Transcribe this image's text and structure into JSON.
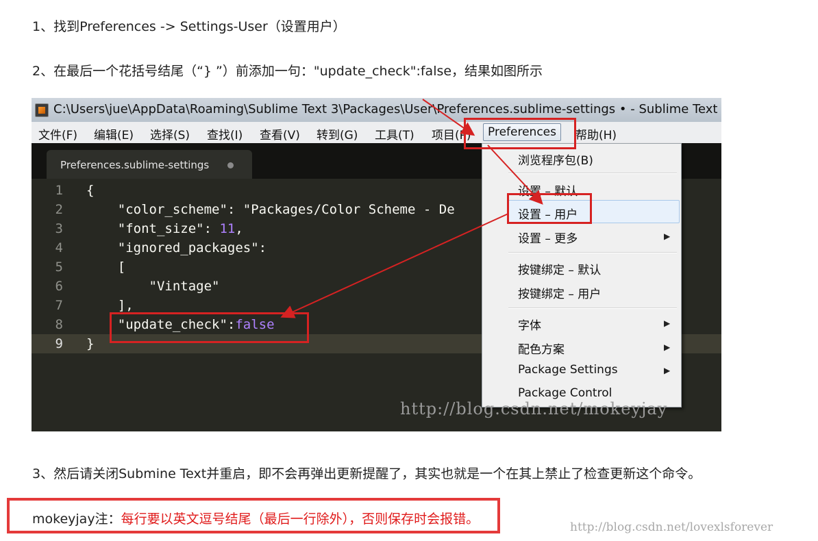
{
  "steps": {
    "step1": "1、找到Preferences -> Settings-User（设置用户）",
    "step2": "2、在最后一个花括号结尾（“} ”）前添加一句：\"update_check\":false，结果如图所示",
    "step3": "3、然后请关闭Submine Text并重启，即不会再弹出更新提醒了，其实也就是一个在其上禁止了检查更新这个命令。"
  },
  "window": {
    "title": "C:\\Users\\jue\\AppData\\Roaming\\Sublime Text 3\\Packages\\User\\Preferences.sublime-settings • - Sublime Text"
  },
  "menubar": [
    "文件(F)",
    "编辑(E)",
    "选择(S)",
    "查找(I)",
    "查看(V)",
    "转到(G)",
    "工具(T)",
    "项目(P)",
    "Preferences",
    "帮助(H)"
  ],
  "tab": {
    "label": "Preferences.sublime-settings"
  },
  "editor": {
    "line_numbers": [
      "1",
      "2",
      "3",
      "4",
      "5",
      "6",
      "7",
      "8",
      "9"
    ],
    "lines": [
      "{",
      "    \"color_scheme\": \"Packages/Color Scheme - De",
      "    \"font_size\": ",
      "    \"ignored_packages\":",
      "    [",
      "        \"Vintage\"",
      "    ],",
      "    \"update_check\":",
      "}"
    ],
    "font_size_value": "11",
    "font_size_tail": ",",
    "update_value": "false"
  },
  "dropdown": [
    "浏览程序包(B)",
    "设置 – 默认",
    "设置 – 用户",
    "设置 – 更多",
    "按键绑定 – 默认",
    "按键绑定 – 用户",
    "字体",
    "配色方案",
    "Package Settings",
    "Package Control"
  ],
  "watermark_shot": "http://blog.csdn.net/mokeyjay",
  "note": {
    "prefix": "mokeyjay注：",
    "text": "每行要以英文逗号结尾（最后一行除外），否则保存时会报错。"
  },
  "watermark_page": "http://blog.csdn.net/lovexlsforever",
  "colors": {
    "annotation_red": "#d62222",
    "editor_bg": "#272822",
    "keyword_purple": "#ae81ff"
  }
}
